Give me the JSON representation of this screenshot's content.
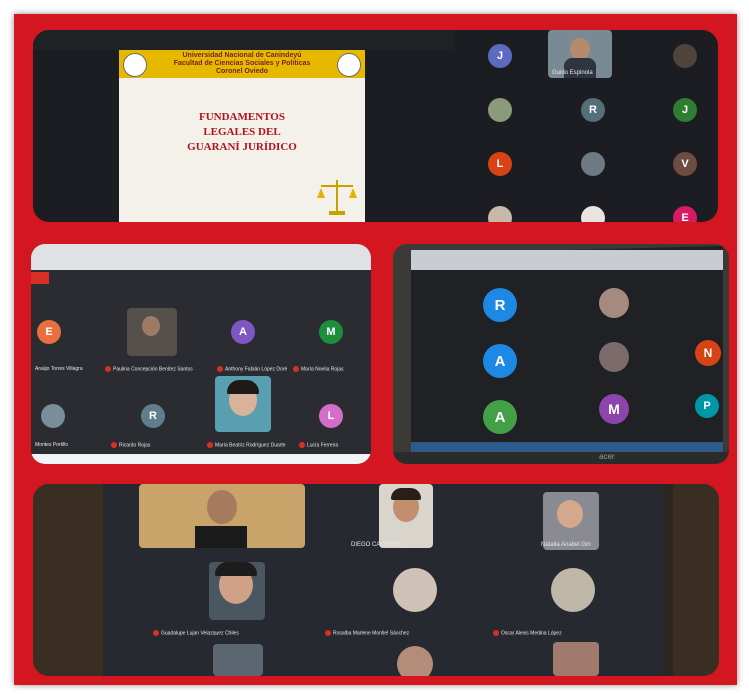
{
  "slide": {
    "header_lines": [
      "Universidad Nacional de Canindeyú",
      "Facultad de Ciencias Sociales y Políticas",
      "Coronel Oviedo"
    ],
    "title_lines": [
      "FUNDAMENTOS",
      "LEGALES DEL",
      "GUARANÍ JURÍDICO"
    ]
  },
  "panel1": {
    "tiles": [
      {
        "letter": "J",
        "color": "#5c6bc0"
      },
      {
        "letter": "R",
        "color": "#546e7a"
      },
      {
        "letter": "J",
        "color": "#2e7d32"
      },
      {
        "letter": "L",
        "color": "#d84315"
      },
      {
        "letter": "V",
        "color": "#6d4c41"
      },
      {
        "letter": "E",
        "color": "#d81b60"
      }
    ],
    "presenter_name": "Guido Espinola"
  },
  "panel2": {
    "tiles": [
      {
        "letter": "E",
        "color": "#e8703f"
      },
      {
        "letter": "A",
        "color": "#7e57c2"
      },
      {
        "letter": "M",
        "color": "#1e8e3e"
      },
      {
        "letter": "R",
        "color": "#607d8b"
      },
      {
        "letter": "L",
        "color": "#d56ec9"
      }
    ],
    "names": [
      "Paulina Concepción Benítez Santos",
      "Anthony Fabián López Doré",
      "María Noelia Rojas",
      "Ricardo Rojas",
      "María Beatriz Rodríguez Duarte",
      "Lucía Ferreira",
      "Araújo Torres Villagra",
      "Montes Portillo"
    ]
  },
  "panel3": {
    "tiles": [
      {
        "letter": "R",
        "color": "#1e88e5"
      },
      {
        "letter": "A",
        "color": "#1e88e5"
      },
      {
        "letter": "A",
        "color": "#43a047"
      },
      {
        "letter": "M",
        "color": "#8e44ad"
      },
      {
        "letter": "N",
        "color": "#d84315"
      },
      {
        "letter": "P",
        "color": "#0097a7"
      }
    ],
    "laptop_brand": "acer"
  },
  "panel4": {
    "names": [
      "DIEGO CACERES",
      "Natalia Anabel Gin",
      "Guadalupe Lujan Velazquez Chiles",
      "Rosalba Marlene Montiel Sánchez",
      "Oscar Alexis Medina López"
    ]
  }
}
